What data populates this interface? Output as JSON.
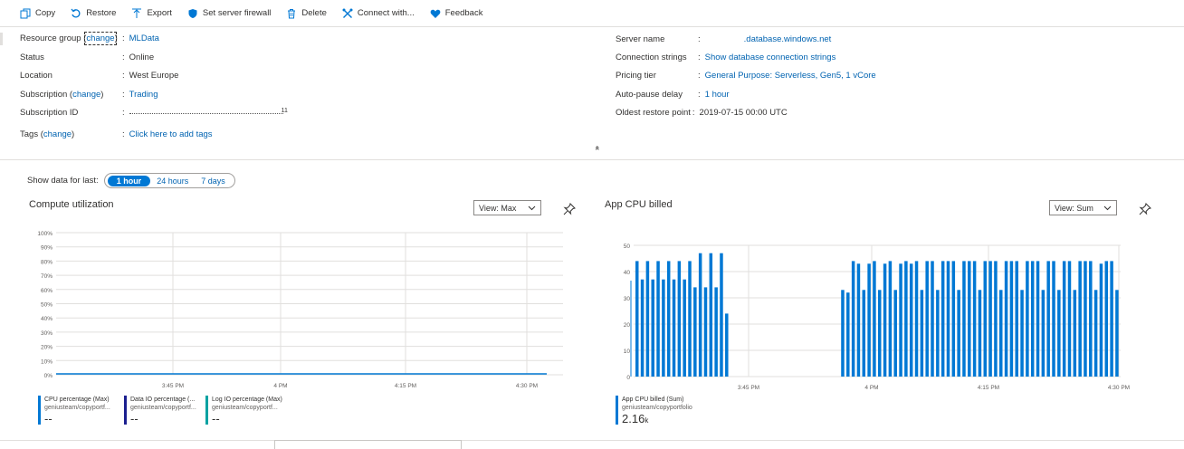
{
  "toolbar": {
    "copy": "Copy",
    "restore": "Restore",
    "export": "Export",
    "firewall": "Set server firewall",
    "delete": "Delete",
    "connect": "Connect with...",
    "feedback": "Feedback"
  },
  "essentials": {
    "resource_group": {
      "key": "Resource group (",
      "change": "change",
      "close": ")",
      "value": "MLData"
    },
    "status": {
      "key": "Status",
      "value": "Online"
    },
    "location": {
      "key": "Location",
      "value": "West Europe"
    },
    "subscription": {
      "key": "Subscription (",
      "change": "change",
      "close": ")",
      "value": "Trading"
    },
    "subscription_id": {
      "key": "Subscription ID",
      "value": "11"
    },
    "tags": {
      "key": "Tags (",
      "change": "change",
      "close": ")",
      "value": "Click here to add tags"
    },
    "server_name": {
      "key": "Server name",
      "value": ".database.windows.net"
    },
    "connection_strings": {
      "key": "Connection strings",
      "value": "Show database connection strings"
    },
    "pricing_tier": {
      "key": "Pricing tier",
      "value": "General Purpose: Serverless, Gen5, 1 vCore"
    },
    "auto_pause": {
      "key": "Auto-pause delay",
      "value": "1 hour"
    },
    "oldest_restore": {
      "key": "Oldest restore point",
      "value": "2019-07-15 00:00 UTC"
    },
    "colon": ":"
  },
  "time_range": {
    "label": "Show data for last:",
    "options": [
      "1 hour",
      "24 hours",
      "7 days"
    ],
    "selected": "1 hour"
  },
  "compute_chart": {
    "title": "Compute utilization",
    "view": "View: Max",
    "y_ticks": [
      "100%",
      "90%",
      "80%",
      "70%",
      "60%",
      "50%",
      "40%",
      "30%",
      "20%",
      "10%",
      "0%"
    ],
    "x_ticks": [
      "3:45 PM",
      "4 PM",
      "4:15 PM",
      "4:30 PM"
    ],
    "legend": [
      {
        "name": "CPU percentage (Max)",
        "sub": "geniusteam/copyportf...",
        "value": "--",
        "color": "#0078d4"
      },
      {
        "name": "Data IO percentage (...",
        "sub": "geniusteam/copyportf...",
        "value": "--",
        "color": "#1b1f8f"
      },
      {
        "name": "Log IO percentage (Max)",
        "sub": "geniusteam/copyportf...",
        "value": "--",
        "color": "#00a2a2"
      }
    ]
  },
  "cpu_billed_chart": {
    "title": "App CPU billed",
    "view": "View: Sum",
    "legend": {
      "name": "App CPU billed (Sum)",
      "sub": "geniusteam/copyportfolio",
      "value": "2.16",
      "unit": "k",
      "color": "#0078d4"
    }
  },
  "chart_data": [
    {
      "type": "line",
      "title": "Compute utilization",
      "x_ticks": [
        "3:45 PM",
        "4 PM",
        "4:15 PM",
        "4:30 PM"
      ],
      "ylim": [
        0,
        100
      ],
      "y_ticks": [
        "100%",
        "90%",
        "80%",
        "70%",
        "60%",
        "50%",
        "40%",
        "30%",
        "20%",
        "10%",
        "0%"
      ],
      "grid": true,
      "series": [
        {
          "name": "CPU percentage (Max)",
          "values": [
            0,
            0
          ]
        }
      ]
    },
    {
      "type": "bar",
      "title": "App CPU billed",
      "x_ticks": [
        "3:45 PM",
        "4 PM",
        "4:15 PM",
        "4:30 PM"
      ],
      "ylim": [
        0,
        50
      ],
      "y_ticks": [
        "50",
        "40",
        "30",
        "20",
        "10",
        "0"
      ],
      "grid": true,
      "series": [
        {
          "name": "App CPU billed (Sum)",
          "values": [
            44,
            37,
            44,
            37,
            44,
            37,
            44,
            37,
            44,
            37,
            44,
            34,
            47,
            34,
            47,
            34,
            47,
            24,
            0,
            0,
            0,
            0,
            0,
            0,
            0,
            0,
            0,
            0,
            0,
            0,
            0,
            0,
            0,
            0,
            0,
            0,
            0,
            0,
            0,
            33,
            32,
            44,
            43,
            33,
            43,
            44,
            33,
            43,
            44,
            33,
            43,
            44,
            43,
            44,
            33,
            44,
            44,
            33,
            44,
            44,
            44,
            33,
            44,
            44,
            44,
            33,
            44,
            44,
            44,
            33,
            44,
            44,
            44,
            33,
            44,
            44,
            44,
            33,
            44,
            44,
            33,
            44,
            44,
            33,
            44,
            44,
            44,
            33,
            43,
            44,
            44,
            33
          ]
        }
      ]
    }
  ]
}
